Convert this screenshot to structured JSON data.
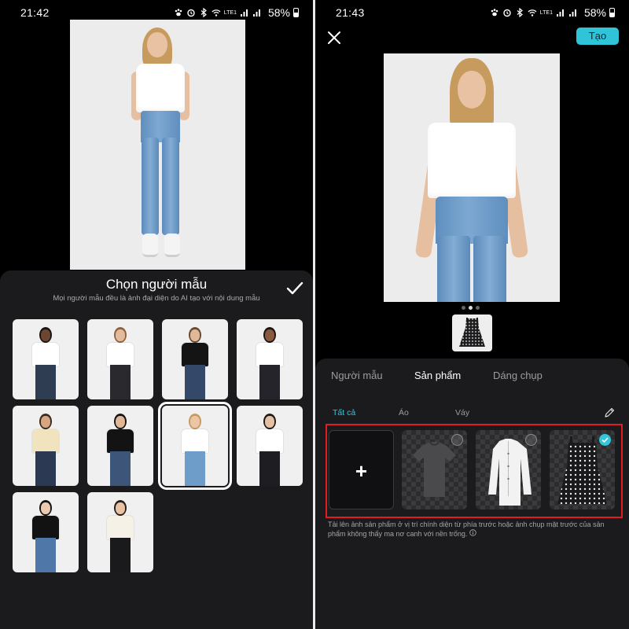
{
  "left_screen": {
    "status": {
      "time": "21:42",
      "battery": "58%",
      "network": "LTE1"
    },
    "sheet": {
      "title": "Chọn người mẫu",
      "subtitle": "Mọi người mẫu đều là ảnh đại diện do AI tạo với nội dung mẫu",
      "selected_index": 6,
      "models": [
        {
          "top": "#ffffff",
          "bottom": "#2f3d52",
          "skin": "#6b4633",
          "hair": "#1b1410"
        },
        {
          "top": "#ffffff",
          "bottom": "#2a2a2e",
          "skin": "#e4bb9a",
          "hair": "#8a6340"
        },
        {
          "top": "#141414",
          "bottom": "#34496a",
          "skin": "#e0b798",
          "hair": "#6a4a2e"
        },
        {
          "top": "#ffffff",
          "bottom": "#24242a",
          "skin": "#8a5a3e",
          "hair": "#1c1410"
        },
        {
          "top": "#f0e3bd",
          "bottom": "#2b3a52",
          "skin": "#d6a582",
          "hair": "#3c2a1c"
        },
        {
          "top": "#131313",
          "bottom": "#3c5578",
          "skin": "#e1b896",
          "hair": "#1a1410"
        },
        {
          "top": "#ffffff",
          "bottom": "#6f9dc9",
          "skin": "#ecc5a6",
          "hair": "#c69a60"
        },
        {
          "top": "#ffffff",
          "bottom": "#1e1e22",
          "skin": "#e5c0a2",
          "hair": "#221a14"
        },
        {
          "top": "#121212",
          "bottom": "#4f78a8",
          "skin": "#eccaaf",
          "hair": "#17120e"
        },
        {
          "top": "#f5f1e6",
          "bottom": "#1a1a1c",
          "skin": "#e8c2a2",
          "hair": "#2a1e16"
        }
      ]
    }
  },
  "right_screen": {
    "status": {
      "time": "21:43",
      "battery": "58%",
      "network": "LTE1"
    },
    "create_label": "Tạo",
    "tabs": [
      "Người mẫu",
      "Sản phẩm",
      "Dáng chụp"
    ],
    "active_tab": "Sản phẩm",
    "filters": [
      "Tất cả",
      "Áo",
      "Váy"
    ],
    "active_filter": "Tất cả",
    "products": [
      {
        "name": "add",
        "label": "+"
      },
      {
        "name": "gray-tshirt",
        "selected": false
      },
      {
        "name": "white-shirt",
        "selected": false
      },
      {
        "name": "polka-dot-dress",
        "selected": true
      }
    ],
    "hint": "Tải lên ảnh sản phẩm ở vị trí chính diện từ phía trước hoặc ảnh chụp mặt trước của sản phẩm không thấy ma nơ canh với nền trống.",
    "carousel": {
      "count": 3,
      "active": 1
    }
  },
  "colors": {
    "accent": "#34c6da",
    "highlight_border": "#e31b23",
    "sheet_bg": "#1b1b1d"
  }
}
